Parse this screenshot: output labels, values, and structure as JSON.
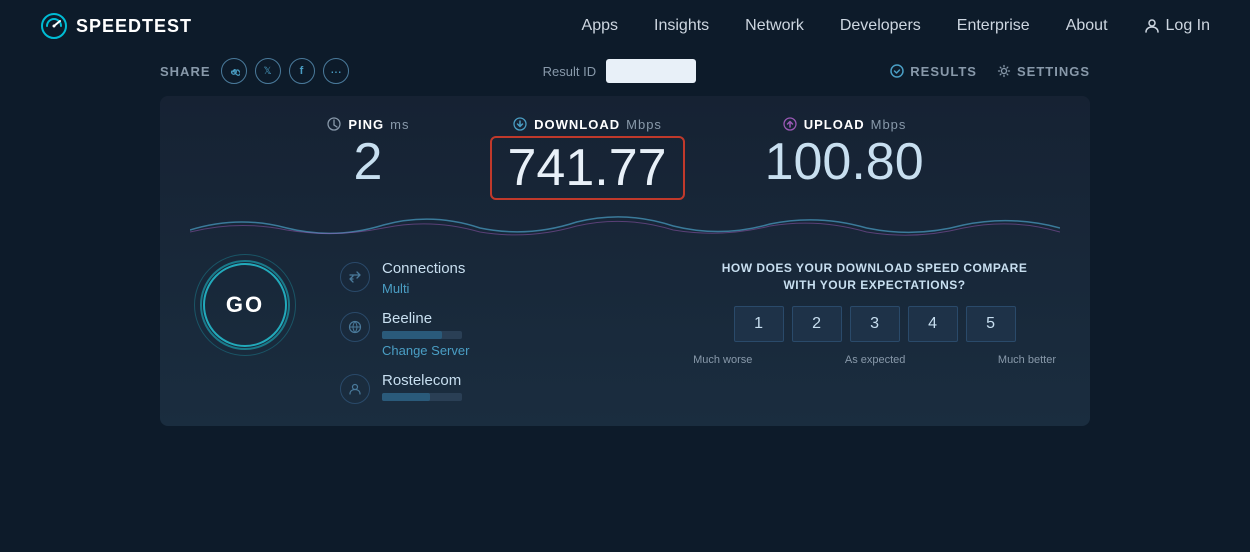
{
  "logo": {
    "text": "SPEEDTEST"
  },
  "nav": {
    "items": [
      {
        "label": "Apps",
        "id": "apps"
      },
      {
        "label": "Insights",
        "id": "insights"
      },
      {
        "label": "Network",
        "id": "network"
      },
      {
        "label": "Developers",
        "id": "developers"
      },
      {
        "label": "Enterprise",
        "id": "enterprise"
      },
      {
        "label": "About",
        "id": "about"
      }
    ],
    "login": "Log In"
  },
  "toolbar": {
    "share_label": "SHARE",
    "result_label": "Result ID",
    "result_value": "",
    "results_btn": "RESULTS",
    "settings_btn": "SETTINGS"
  },
  "speed": {
    "ping_label": "PING",
    "ping_unit": "ms",
    "ping_value": "2",
    "download_label": "DOWNLOAD",
    "download_unit": "Mbps",
    "download_value": "741.77",
    "upload_label": "UPLOAD",
    "upload_unit": "Mbps",
    "upload_value": "100.80"
  },
  "go_button": "GO",
  "connections": {
    "label": "Connections",
    "value": "Multi"
  },
  "server_beeline": {
    "name": "Beeline",
    "change_label": "Change Server"
  },
  "server_rostelecom": {
    "name": "Rostelecom"
  },
  "expectation": {
    "title": "HOW DOES YOUR DOWNLOAD SPEED COMPARE\nWITH YOUR EXPECTATIONS?",
    "ratings": [
      "1",
      "2",
      "3",
      "4",
      "5"
    ],
    "label_left": "Much worse",
    "label_mid": "As expected",
    "label_right": "Much better"
  }
}
